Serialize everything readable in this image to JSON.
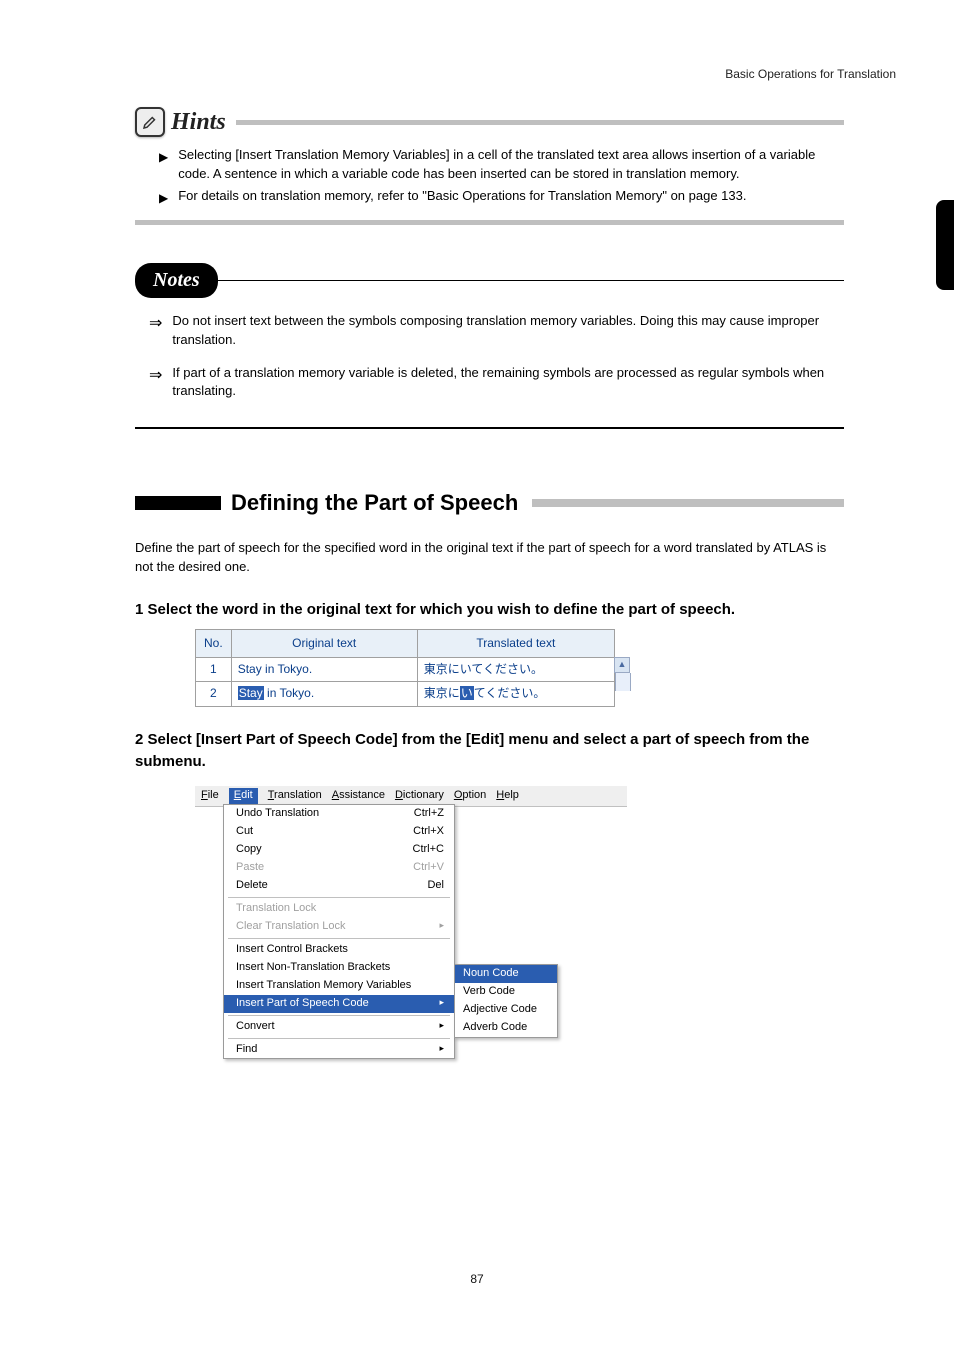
{
  "page": {
    "top_right": "Basic Operations for Translation",
    "footer": "87"
  },
  "hints": {
    "title": "Hints",
    "items": [
      "Selecting [Insert Translation Memory Variables] in a cell of the translated text area allows insertion of a variable code. A sentence in which a variable code has been inserted can be stored in translation memory.",
      "For details on translation memory, refer to \"Basic Operations for Translation Memory\" on page 133."
    ]
  },
  "notes": {
    "title": "Notes",
    "items": [
      "Do not insert text between the symbols composing translation memory variables. Doing this may cause improper translation.",
      "If part of a translation memory variable is deleted, the remaining symbols are processed as regular symbols when translating."
    ]
  },
  "section": {
    "title": "Defining the Part of Speech",
    "intro": "Define the part of speech for the specified word in the original text if the part of speech for a word translated by ATLAS is not the desired one."
  },
  "step1": {
    "title": "1 Select the word in the original text for which you wish to define the part of speech.",
    "table": {
      "headers": {
        "no": "No.",
        "orig": "Original text",
        "trans": "Translated text"
      },
      "rows": [
        {
          "no": "1",
          "orig_plain": "Stay in Tokyo.",
          "trans_plain": "東京にいてください。",
          "hl_orig": "",
          "hl_trans": ""
        },
        {
          "no": "2",
          "orig_pre": "",
          "orig_hl": "Stay",
          "orig_post": " in Tokyo.",
          "trans_pre": "東京に",
          "trans_hl": "い",
          "trans_post": "てください。"
        }
      ]
    }
  },
  "step2": {
    "title": "2 Select [Insert Part of Speech Code] from the [Edit] menu and select a part of speech from the submenu.",
    "menubar": {
      "file": "File",
      "edit": "Edit",
      "translation": "Translation",
      "assistance": "Assistance",
      "dictionary": "Dictionary",
      "option": "Option",
      "help": "Help"
    },
    "dropdown": {
      "undo": {
        "label": "Undo Translation",
        "short": "Ctrl+Z"
      },
      "cut": {
        "label": "Cut",
        "short": "Ctrl+X"
      },
      "copy": {
        "label": "Copy",
        "short": "Ctrl+C"
      },
      "paste": {
        "label": "Paste",
        "short": "Ctrl+V"
      },
      "delete": {
        "label": "Delete",
        "short": "Del"
      },
      "tlock": "Translation Lock",
      "clearlock": "Clear Translation Lock",
      "icb": "Insert Control Brackets",
      "intb": "Insert Non-Translation Brackets",
      "itmv": "Insert Translation Memory Variables",
      "ipos": "Insert Part of Speech Code",
      "convert": "Convert",
      "find": "Find"
    },
    "submenu": {
      "noun": "Noun Code",
      "verb": "Verb Code",
      "adj": "Adjective Code",
      "adv": "Adverb Code"
    }
  }
}
